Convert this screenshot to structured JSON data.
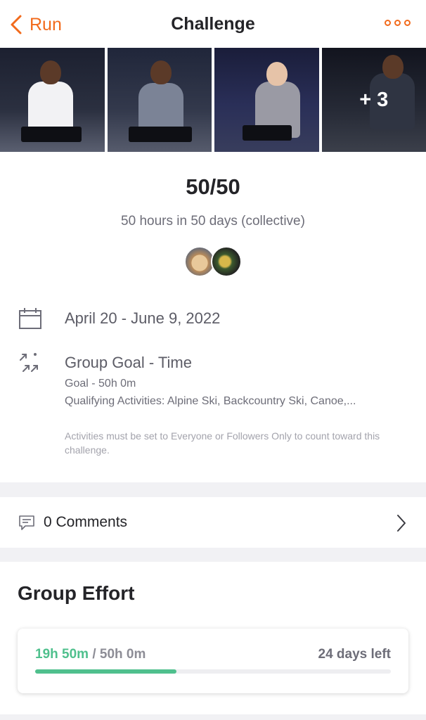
{
  "header": {
    "back_label": "Run",
    "title": "Challenge",
    "more_icon": "more-dots-icon"
  },
  "photos": {
    "extra_count": "+ 3"
  },
  "challenge": {
    "name": "50/50",
    "description": "50 hours in 50 days (collective)",
    "dates": "April 20 - June 9, 2022",
    "goal_type": "Group Goal - Time",
    "goal": "Goal - 50h 0m",
    "qualifying": "Qualifying Activities: Alpine Ski, Backcountry Ski, Canoe,...",
    "disclaimer": "Activities must be set to Everyone or Followers Only to count toward this challenge."
  },
  "comments": {
    "label": "0 Comments"
  },
  "group_effort": {
    "title": "Group Effort",
    "current": "19h 50m",
    "separator": " / ",
    "total": "50h 0m",
    "days_left": "24 days left",
    "progress_fraction": 0.397
  },
  "colors": {
    "accent": "#f26a1b",
    "progress": "#4fc08d"
  }
}
